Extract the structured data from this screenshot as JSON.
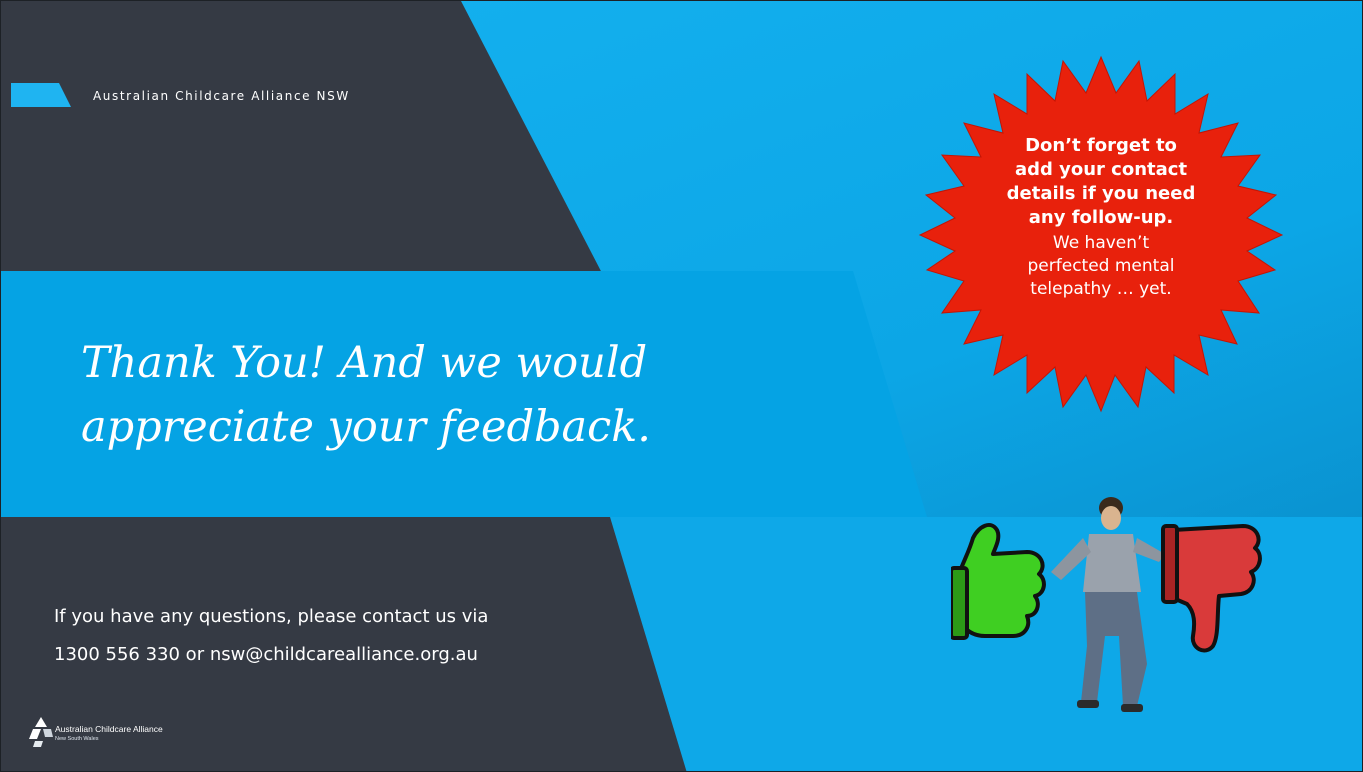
{
  "slide": {
    "header_label": "Australian Childcare Alliance NSW",
    "headline": {
      "line1": "Thank You! And we would",
      "line2": "appreciate your feedback."
    },
    "contact": {
      "line1": "If you have any questions, please contact us via",
      "line2": "1300 556 330 or nsw@childcarealliance.org.au"
    },
    "logo": {
      "name": "Australian Childcare Alliance",
      "region": "New South Wales"
    }
  },
  "callout": {
    "bold_lines": [
      "Don’t forget to",
      "add your contact",
      "details if you need",
      "any follow-up."
    ],
    "normal_lines": [
      "We haven’t",
      "perfected mental",
      "telepathy … yet."
    ]
  },
  "illustration": {
    "icons": [
      "thumbs-up-icon",
      "thumbs-down-icon"
    ]
  },
  "colors": {
    "sky_blue": "#15b2f0",
    "dark_panel": "#353a44",
    "banner_blue": "#05a3e4",
    "burst_red": "#e8210c",
    "thumb_green": "#3fcf22",
    "thumb_red": "#d93a3a"
  }
}
